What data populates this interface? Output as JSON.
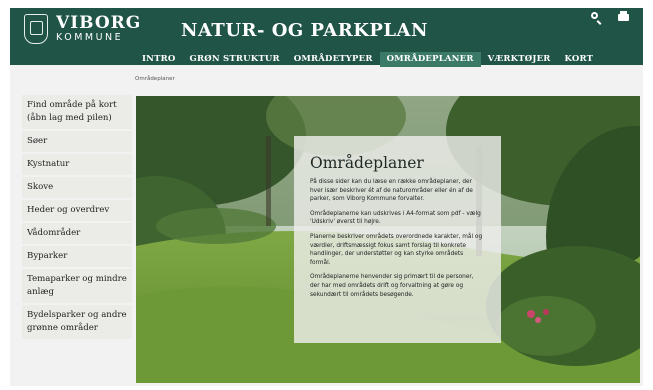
{
  "logo": {
    "name": "VIBORG",
    "sub": "KOMMUNE"
  },
  "site_title": "NATUR- OG PARKPLAN",
  "header_icons": [
    "search-icon",
    "print-icon"
  ],
  "nav": {
    "items": [
      {
        "label": "INTRO"
      },
      {
        "label": "GRØN STRUKTUR"
      },
      {
        "label": "OMRÅDETYPER"
      },
      {
        "label": "OMRÅDEPLANER",
        "active": true
      },
      {
        "label": "VÆRKTØJER"
      },
      {
        "label": "KORT"
      }
    ]
  },
  "breadcrumb": "Områdeplaner",
  "sidebar": {
    "items": [
      {
        "label": "Find område på kort (åbn lag med pilen)"
      },
      {
        "label": "Søer"
      },
      {
        "label": "Kystnatur"
      },
      {
        "label": "Skove"
      },
      {
        "label": "Heder og overdrev"
      },
      {
        "label": "Vådområder"
      },
      {
        "label": "Byparker"
      },
      {
        "label": "Temaparker og mindre anlæg"
      },
      {
        "label": "Bydelsparker og andre grønne områder"
      }
    ]
  },
  "main": {
    "title": "Områdeplaner",
    "paragraphs": [
      "På disse sider kan du læse en række områdeplaner, der hver især beskriver ét af de naturområder eller én af de parker, som Viborg Kommune forvalter.",
      "Områdeplanerne kan udskrives i A4-format som pdf - vælg 'Udskriv' øverst til højre.",
      "Planerne beskriver områdets overordnede karakter, mål og værdier, driftsmæssigt fokus samt forslag til konkrete handlinger, der understøtter og kan styrke områdets formål.",
      "Områdeplanerne henvender sig primært til de personer, der har med områdets drift og forvaltning at gøre og sekundært til områdets besøgende."
    ]
  },
  "colors": {
    "header": "#1f5446",
    "nav_active": "#3c7a68",
    "sidebar_item": "#ebebe8",
    "page": "#f2f2f2"
  }
}
